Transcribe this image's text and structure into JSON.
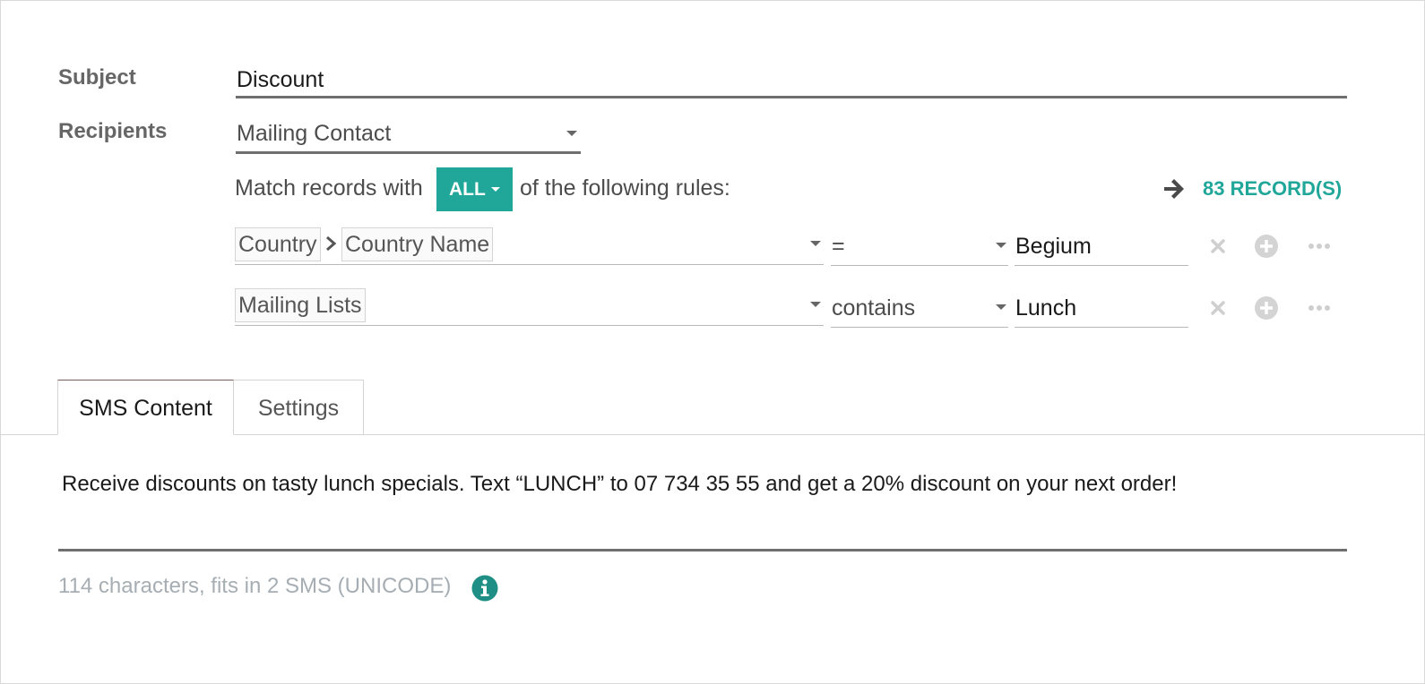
{
  "form": {
    "subject_label": "Subject",
    "subject_value": "Discount",
    "recipients_label": "Recipients",
    "recipients_value": "Mailing Contact"
  },
  "domain": {
    "match_prefix": "Match records with",
    "match_mode": "ALL",
    "match_suffix": "of the following rules:",
    "record_count": "83 RECORD(S)",
    "rules": [
      {
        "path": [
          "Country",
          "Country Name"
        ],
        "operator": "=",
        "value": "Begium"
      },
      {
        "path": [
          "Mailing Lists"
        ],
        "operator": "contains",
        "value": "Lunch"
      }
    ]
  },
  "tabs": [
    {
      "label": "SMS Content",
      "active": true
    },
    {
      "label": "Settings",
      "active": false
    }
  ],
  "sms": {
    "body": "Receive discounts on tasty lunch specials. Text “LUNCH” to 07 734 35 55 and get a 20% discount on your next order!",
    "char_info": "114 characters, fits in 2 SMS (UNICODE)"
  },
  "colors": {
    "accent": "#21a79a",
    "muted_text": "#a6aeb3",
    "label_text": "#666666"
  },
  "icons": {
    "arrow": "arrow-right-icon",
    "path_separator": "chevron-right-icon",
    "delete": "close-icon",
    "add": "plus-circle-icon",
    "more": "ellipsis-icon",
    "info": "info-circle-icon"
  }
}
